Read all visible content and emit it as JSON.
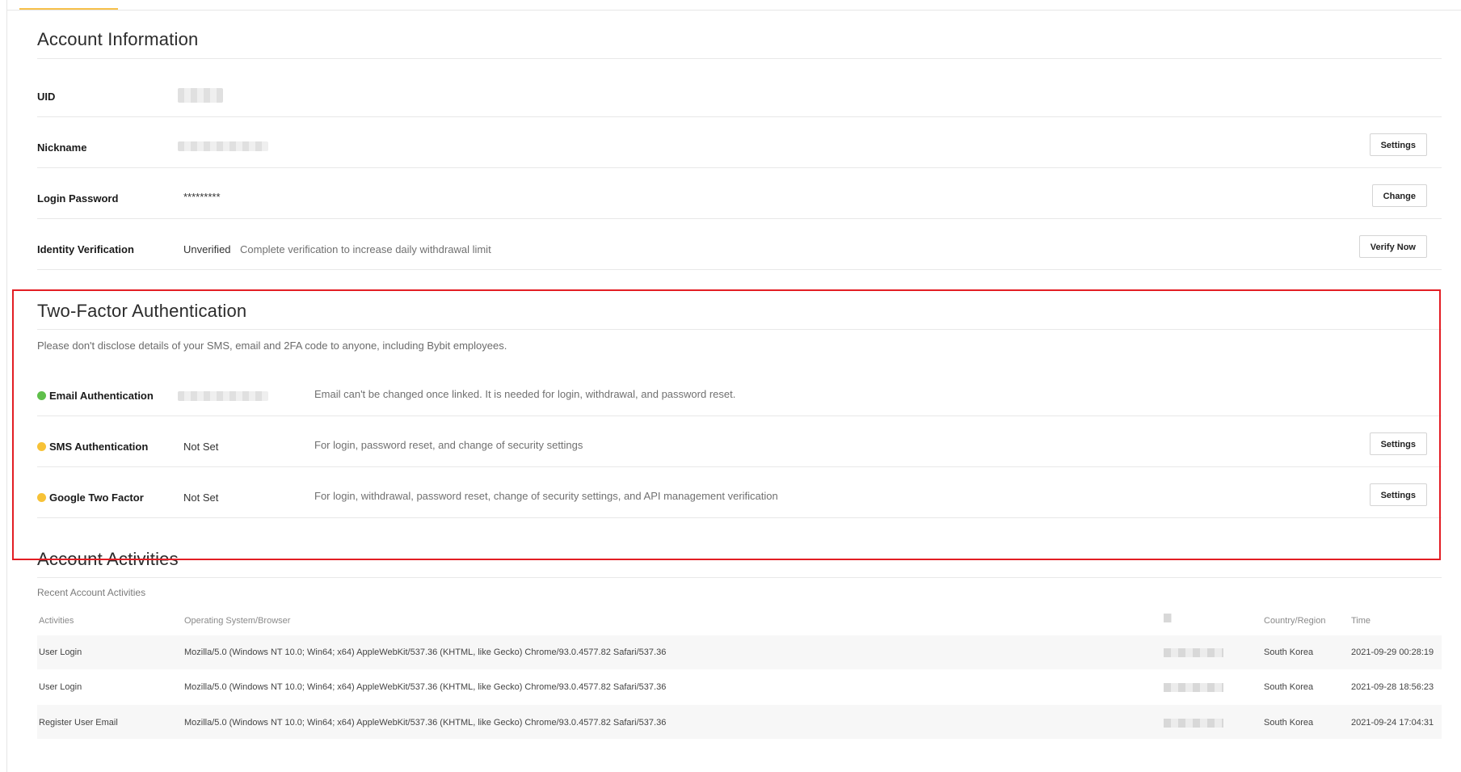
{
  "account": {
    "title": "Account Information",
    "uid_label": "UID",
    "nickname_label": "Nickname",
    "nickname_button": "Settings",
    "password_label": "Login Password",
    "password_value": "*********",
    "password_button": "Change",
    "identity_label": "Identity Verification",
    "identity_status": "Unverified",
    "identity_desc": "Complete verification to increase daily withdrawal limit",
    "identity_button": "Verify Now"
  },
  "twofa": {
    "title": "Two-Factor Authentication",
    "note": "Please don't disclose details of your SMS, email and 2FA code to anyone, including Bybit employees.",
    "email_label": "Email Authentication",
    "email_desc": "Email can't be changed once linked. It is needed for login, withdrawal, and password reset.",
    "sms_label": "SMS Authentication",
    "sms_status": "Not Set",
    "sms_desc": "For login, password reset, and change of security settings",
    "sms_button": "Settings",
    "google_label": "Google Two Factor",
    "google_status": "Not Set",
    "google_desc": "For login, withdrawal, password reset, change of security settings, and API management verification",
    "google_button": "Settings"
  },
  "activities": {
    "title": "Account Activities",
    "subtitle": "Recent Account Activities",
    "columns": {
      "activity": "Activities",
      "os": "Operating System/Browser",
      "country": "Country/Region",
      "time": "Time"
    },
    "rows": [
      {
        "activity": "User Login",
        "os": "Mozilla/5.0 (Windows NT 10.0; Win64; x64) AppleWebKit/537.36 (KHTML, like Gecko) Chrome/93.0.4577.82 Safari/537.36",
        "country": "South Korea",
        "time": "2021-09-29 00:28:19"
      },
      {
        "activity": "User Login",
        "os": "Mozilla/5.0 (Windows NT 10.0; Win64; x64) AppleWebKit/537.36 (KHTML, like Gecko) Chrome/93.0.4577.82 Safari/537.36",
        "country": "South Korea",
        "time": "2021-09-28 18:56:23"
      },
      {
        "activity": "Register User Email",
        "os": "Mozilla/5.0 (Windows NT 10.0; Win64; x64) AppleWebKit/537.36 (KHTML, like Gecko) Chrome/93.0.4577.82 Safari/537.36",
        "country": "South Korea",
        "time": "2021-09-24 17:04:31"
      }
    ]
  },
  "colors": {
    "accent": "#f7c04a",
    "verified": "#5fbf4b",
    "not_set": "#f7c237",
    "highlight": "#e31e24"
  }
}
